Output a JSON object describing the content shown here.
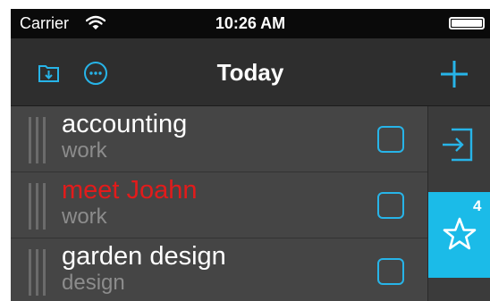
{
  "status_bar": {
    "carrier": "Carrier",
    "time": "10:26 AM"
  },
  "nav": {
    "title": "Today",
    "left_icons": [
      "inbox-download-icon",
      "more-options-icon"
    ],
    "right_icon": "plus-icon"
  },
  "tasks": [
    {
      "title": "accounting",
      "category": "work",
      "title_color": "#ffffff",
      "checked": false
    },
    {
      "title": "meet Joahn",
      "category": "work",
      "title_color": "#e21b1b",
      "checked": false
    },
    {
      "title": "garden design",
      "category": "design",
      "title_color": "#ffffff",
      "checked": false
    }
  ],
  "sidebar": {
    "items": [
      {
        "icon": "login-arrow-icon",
        "badge": ""
      },
      {
        "icon": "star-icon",
        "badge": "4",
        "active": true
      }
    ]
  },
  "colors": {
    "accent": "#1bbbe8",
    "status_bar_bg": "#0a0a0a",
    "nav_bg": "#2e2e2e",
    "list_bg": "#454545",
    "important_text": "#e21b1b"
  }
}
